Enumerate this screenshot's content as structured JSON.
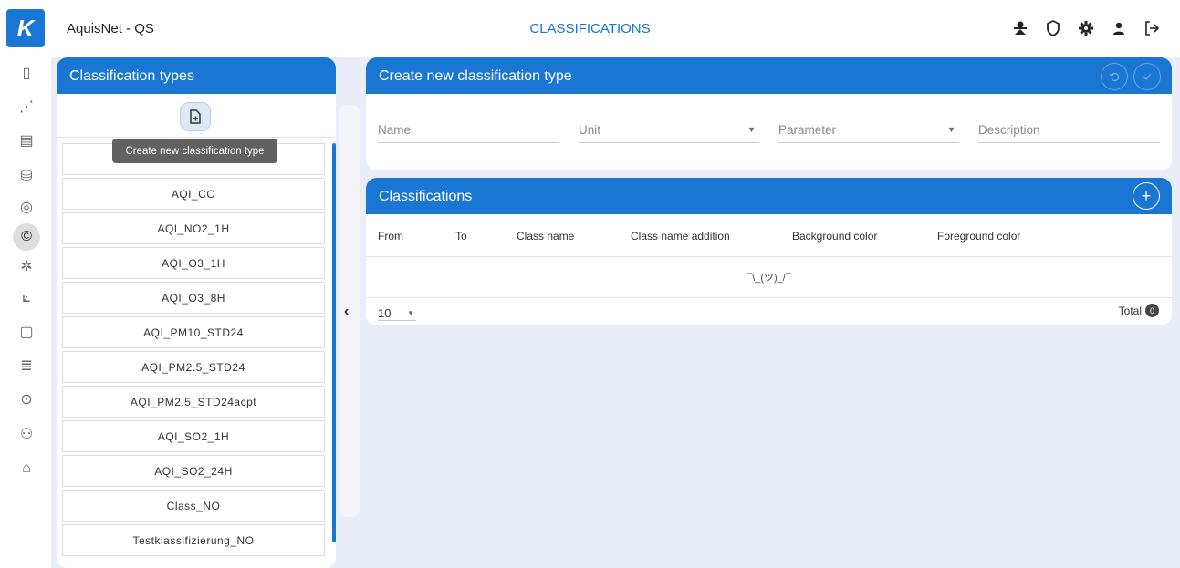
{
  "app": {
    "title": "AquisNet - QS",
    "logo_text": "K"
  },
  "page": {
    "title": "CLASSIFICATIONS"
  },
  "top_icons": [
    "user-admin-icon",
    "shield-icon",
    "gear-icon",
    "person-icon",
    "logout-icon"
  ],
  "sidenav": {
    "items": [
      {
        "icon": "map-icon",
        "glyph": "▯"
      },
      {
        "icon": "trend-icon",
        "glyph": "⋰"
      },
      {
        "icon": "report-icon",
        "glyph": "▤"
      },
      {
        "icon": "database-icon",
        "glyph": "⛁"
      },
      {
        "icon": "fingerprint-icon",
        "glyph": "◎"
      },
      {
        "icon": "copyright-icon",
        "glyph": "©",
        "active": true
      },
      {
        "icon": "bug-icon",
        "glyph": "✲"
      },
      {
        "icon": "chart-icon",
        "glyph": "⟀"
      },
      {
        "icon": "clipboard-icon",
        "glyph": "▢"
      },
      {
        "icon": "document-list-icon",
        "glyph": "≣"
      },
      {
        "icon": "target-icon",
        "glyph": "⊙"
      },
      {
        "icon": "user-settings-icon",
        "glyph": "⚇"
      },
      {
        "icon": "factory-icon",
        "glyph": "⌂"
      }
    ]
  },
  "left_panel": {
    "title": "Classification types",
    "tooltip": "Create new classification type",
    "items": [
      "AQI_CO",
      "AQI_NO2_1H",
      "AQI_O3_1H",
      "AQI_O3_8H",
      "AQI_PM10_STD24",
      "AQI_PM2.5_STD24",
      "AQI_PM2.5_STD24acpt",
      "AQI_SO2_1H",
      "AQI_SO2_24H",
      "Class_NO",
      "Testklassifizierung_NO"
    ]
  },
  "create_panel": {
    "title": "Create new classification type",
    "fields": {
      "name_placeholder": "Name",
      "unit_placeholder": "Unit",
      "parameter_placeholder": "Parameter",
      "description_placeholder": "Description"
    }
  },
  "class_panel": {
    "title": "Classifications",
    "columns": [
      "From",
      "To",
      "Class name",
      "Class name addition",
      "Background color",
      "Foreground color"
    ],
    "empty_text": "¯\\_(ツ)_/¯",
    "page_size": "10",
    "total_label": "Total",
    "total_count": "0"
  },
  "colors": {
    "accent": "#1976d2",
    "background": "#e8edf7"
  }
}
